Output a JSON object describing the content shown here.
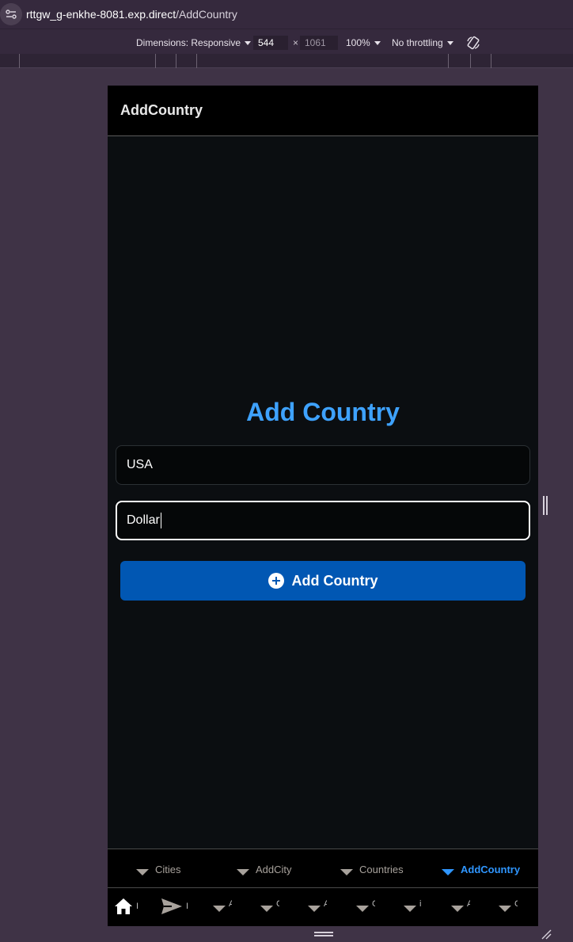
{
  "browser": {
    "url_host": "rttgw_g-enkhe-8081.exp.direct",
    "url_path": "/AddCountry",
    "site_info_icon": "tune-icon"
  },
  "devtools": {
    "dimensions_label": "Dimensions: Responsive",
    "width": "544",
    "separator": "×",
    "height": "1061",
    "zoom": "100%",
    "throttling": "No throttling",
    "rotate_icon": "rotate-icon"
  },
  "app": {
    "header_title": "AddCountry",
    "form_title": "Add Country",
    "country_value": "USA",
    "currency_value": "Dollar",
    "submit_label": "Add Country",
    "submit_icon": "plus-circle-icon",
    "accent_color": "#3ea2ff",
    "button_color": "#0157b3"
  },
  "top_tabs": [
    {
      "label": "Cities",
      "active": false
    },
    {
      "label": "AddCity",
      "active": false
    },
    {
      "label": "Countries",
      "active": false
    },
    {
      "label": "AddCountry",
      "active": true
    }
  ],
  "bottom_tabs": {
    "home_icon": "home-icon",
    "send_icon": "send-icon",
    "items": [
      "I",
      "I",
      "A",
      "C",
      "A",
      "C",
      "i",
      "A",
      "C"
    ]
  }
}
